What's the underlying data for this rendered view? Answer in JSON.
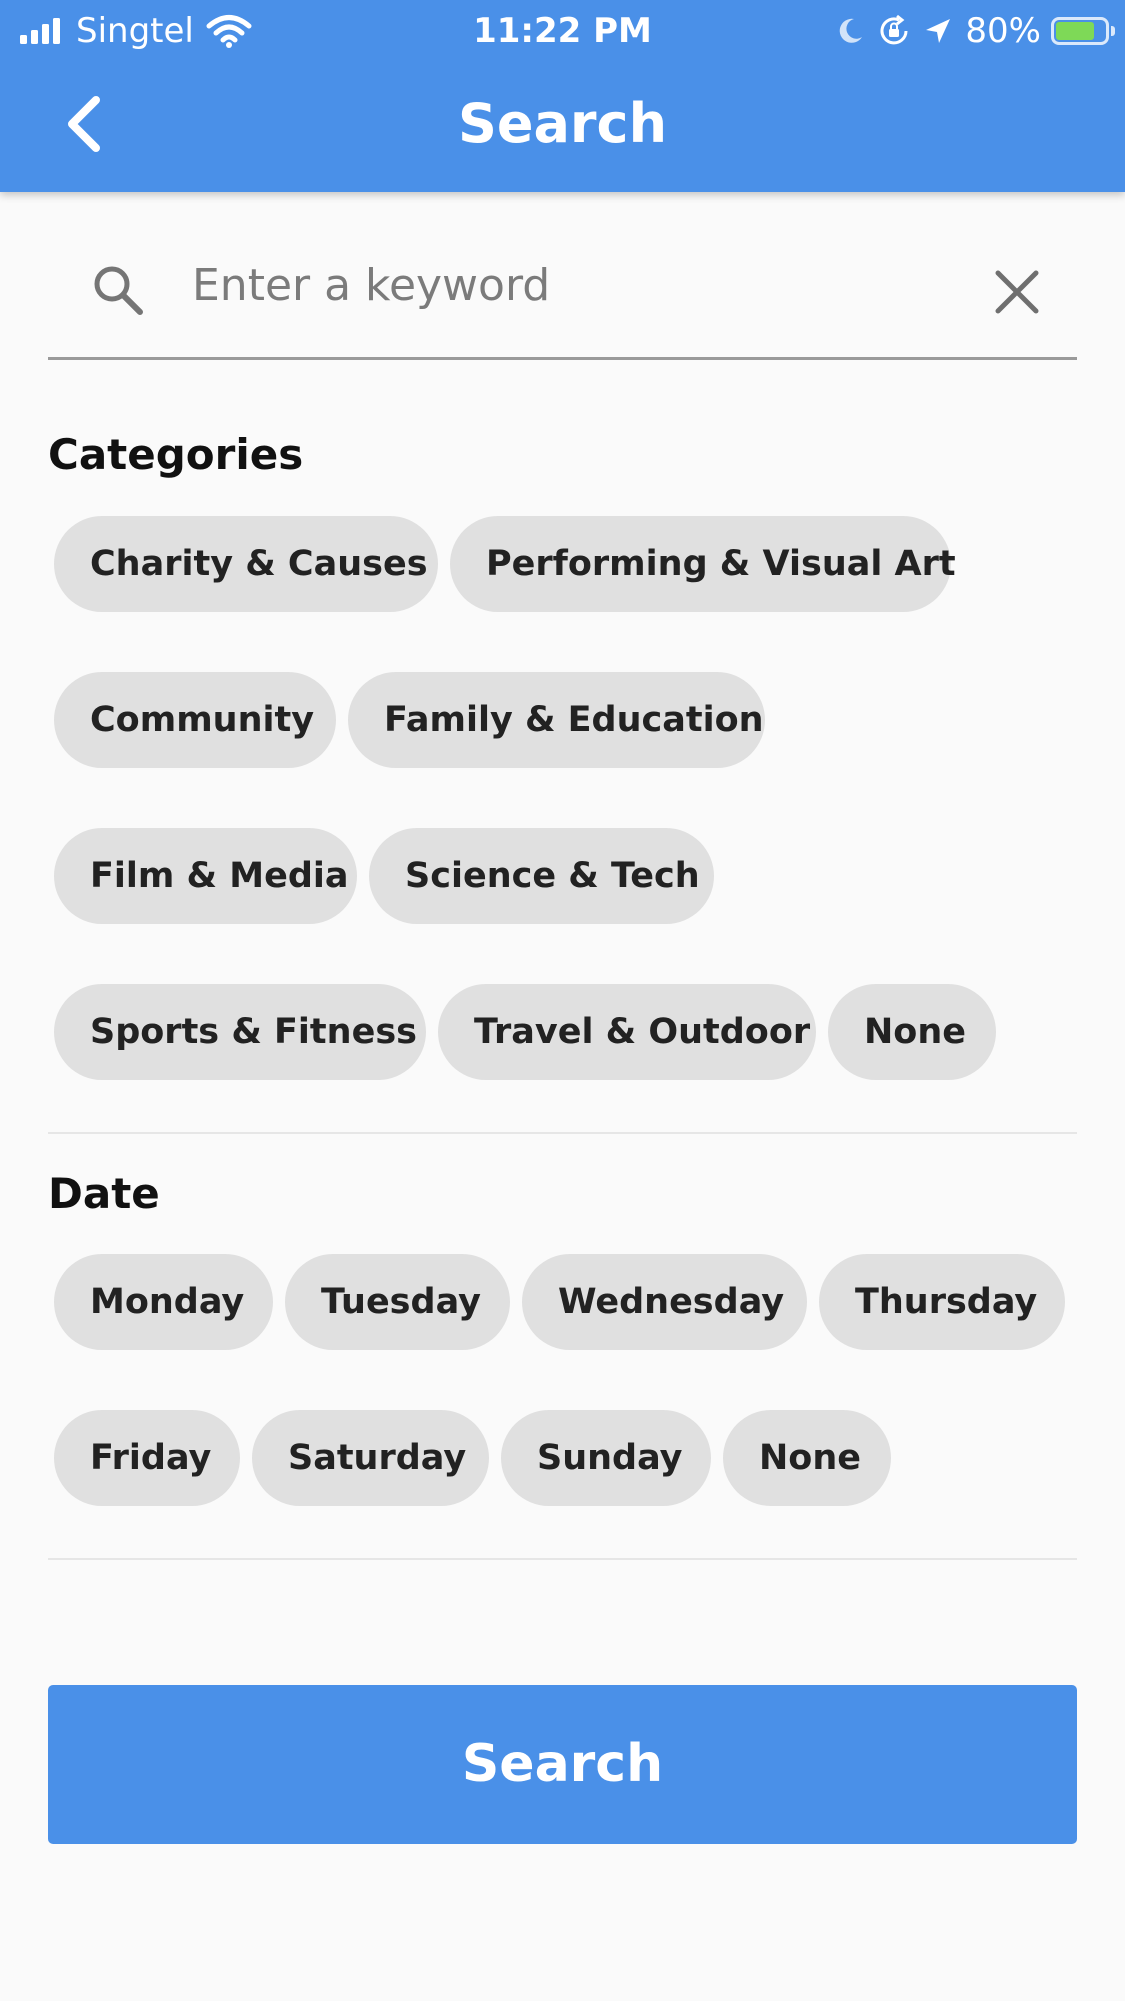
{
  "status_bar": {
    "carrier": "Singtel",
    "time": "11:22 PM",
    "battery": "80%",
    "battery_level": 0.8,
    "icons": [
      "signal-icon",
      "wifi-icon",
      "moon-icon",
      "orientation-lock-icon",
      "location-arrow-icon",
      "battery-charging-icon"
    ]
  },
  "nav": {
    "title": "Search",
    "back_icon": "chevron-left-icon"
  },
  "search": {
    "placeholder": "Enter a keyword",
    "value": "",
    "search_icon": "search-icon",
    "clear_icon": "close-icon"
  },
  "categories": {
    "title": "Categories",
    "chips": [
      "Charity & Causes",
      "Performing & Visual Art",
      "Community",
      "Family & Education",
      "Film & Media",
      "Science & Tech",
      "Sports & Fitness",
      "Travel & Outdoor",
      "None"
    ]
  },
  "date": {
    "title": "Date",
    "chips": [
      "Monday",
      "Tuesday",
      "Wednesday",
      "Thursday",
      "Friday",
      "Saturday",
      "Sunday",
      "None"
    ]
  },
  "search_button": {
    "label": "Search"
  },
  "colors": {
    "primary": "#4a90e8",
    "chip_background": "#e0e0e0",
    "page_background": "#fafafa"
  }
}
